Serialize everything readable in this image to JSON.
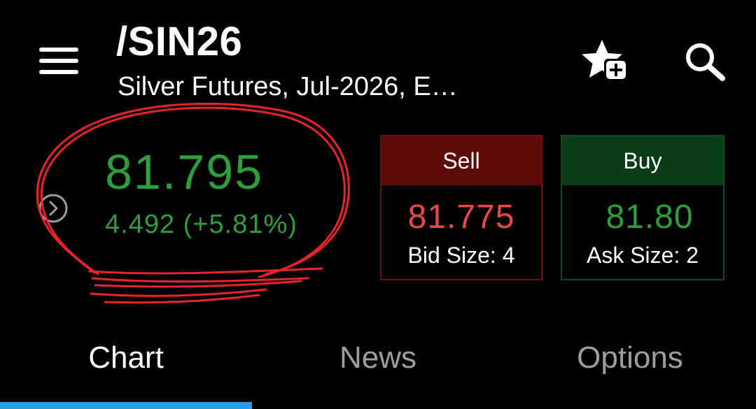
{
  "header": {
    "symbol": "/SIN26",
    "description": "Silver Futures, Jul-2026, E…"
  },
  "quote": {
    "last_price": "81.795",
    "change": "4.492 (+5.81%)",
    "change_color": "#2e9e3c"
  },
  "sell": {
    "label": "Sell",
    "price": "81.775",
    "size": "Bid Size: 4",
    "price_color": "#e84848",
    "header_color": "#5c0a0a"
  },
  "buy": {
    "label": "Buy",
    "price": "81.80",
    "size": "Ask Size: 2",
    "price_color": "#2e9e3c",
    "header_color": "#0a3d16"
  },
  "tabs": [
    {
      "label": "Chart",
      "active": true
    },
    {
      "label": "News",
      "active": false
    },
    {
      "label": "Options",
      "active": false
    }
  ],
  "icons": {
    "menu": "hamburger-menu-icon",
    "favorite": "star-add-icon",
    "search": "search-icon",
    "expand": "chevron-right-circle-icon"
  },
  "colors": {
    "background": "#000000",
    "tab_indicator": "#1e9fe8",
    "annotation": "#e8242a"
  }
}
